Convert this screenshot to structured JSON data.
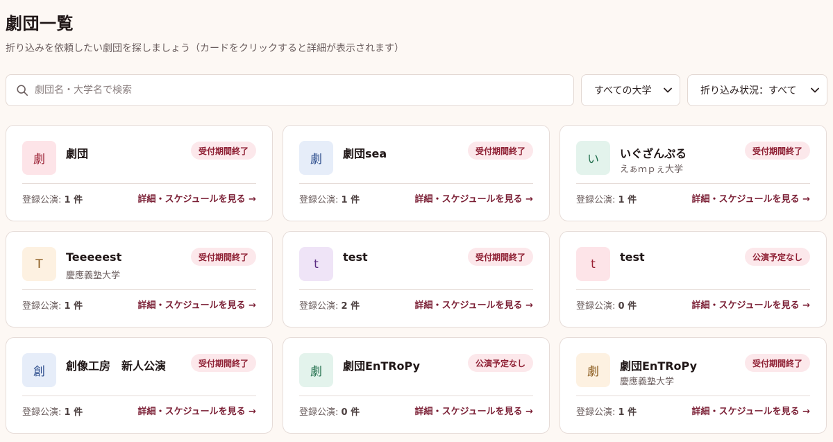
{
  "header": {
    "title": "劇団一覧",
    "subtitle": "折り込みを依頼したい劇団を探しましょう（カードをクリックすると詳細が表示されます）"
  },
  "search": {
    "placeholder": "劇団名・大学名で検索",
    "value": "",
    "icon": "search-icon"
  },
  "filters": {
    "university": {
      "selected": "すべての大学"
    },
    "status": {
      "selected": "折り込み状況：すべて"
    }
  },
  "card_common": {
    "count_label": "登録公演:",
    "detail_link": "詳細・スケジュールを見る →"
  },
  "cards": [
    {
      "initial": "劇",
      "name": "劇団",
      "university": "",
      "badge": "受付期間終了",
      "count": "1 件",
      "avatar_bg": "#fde4e8",
      "avatar_fg": "#9b2235"
    },
    {
      "initial": "劇",
      "name": "劇団sea",
      "university": "",
      "badge": "受付期間終了",
      "count": "1 件",
      "avatar_bg": "#e6edf9",
      "avatar_fg": "#2b4c8c"
    },
    {
      "initial": "い",
      "name": "いぐざんぷる",
      "university": "えぁｍｐぇ大学",
      "badge": "受付期間終了",
      "count": "1 件",
      "avatar_bg": "#e3f3ec",
      "avatar_fg": "#23704e"
    },
    {
      "initial": "T",
      "name": "Teeeeest",
      "university": "慶應義塾大学",
      "badge": "受付期間終了",
      "count": "1 件",
      "avatar_bg": "#fdf1e1",
      "avatar_fg": "#8a5a1c"
    },
    {
      "initial": "t",
      "name": "test",
      "university": "",
      "badge": "受付期間終了",
      "count": "2 件",
      "avatar_bg": "#efe4f7",
      "avatar_fg": "#5b2d82"
    },
    {
      "initial": "t",
      "name": "test",
      "university": "",
      "badge": "公演予定なし",
      "count": "0 件",
      "avatar_bg": "#fde4e8",
      "avatar_fg": "#9b2235"
    },
    {
      "initial": "創",
      "name": "創像工房　新人公演",
      "university": "",
      "badge": "受付期間終了",
      "count": "1 件",
      "avatar_bg": "#e6edf9",
      "avatar_fg": "#2b4c8c"
    },
    {
      "initial": "劇",
      "name": "劇団EnTRoPy",
      "university": "",
      "badge": "公演予定なし",
      "count": "0 件",
      "avatar_bg": "#e3f3ec",
      "avatar_fg": "#23704e"
    },
    {
      "initial": "劇",
      "name": "劇団EnTRoPy",
      "university": "慶應義塾大学",
      "badge": "受付期間終了",
      "count": "1 件",
      "avatar_bg": "#fdf1e1",
      "avatar_fg": "#8a5a1c"
    }
  ]
}
